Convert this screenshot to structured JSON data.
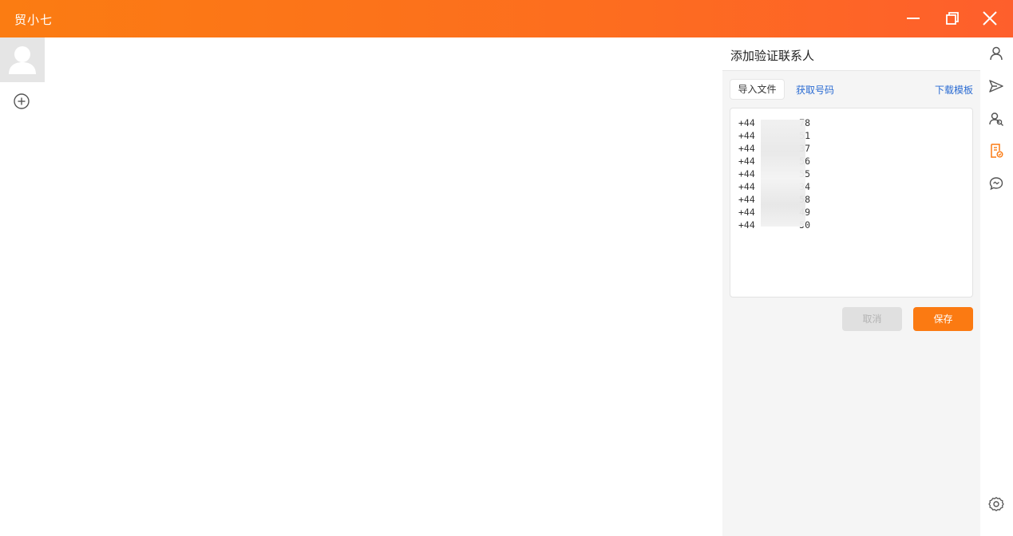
{
  "window": {
    "title": "贸小七"
  },
  "panel": {
    "title": "添加验证联系人",
    "tabs": {
      "import_file": "导入文件",
      "get_numbers": "获取号码",
      "download_template": "下载模板"
    },
    "numbers": [
      "+44        78",
      "+44        51",
      "+44        37",
      "+44        56",
      "+44        55",
      "+44        34",
      "+44        58",
      "+44        49",
      "+44        50"
    ],
    "cancel_label": "取消",
    "save_label": "保存"
  },
  "rail": {
    "active_item": "verify-contacts",
    "icons": [
      "user-icon",
      "send-icon",
      "contacts-icon",
      "verify-doc-icon",
      "chat-icon",
      "settings-icon"
    ]
  },
  "colors": {
    "accent": "#fb7a12",
    "link": "#2a6bd2",
    "titlebar_start": "#fb7c12",
    "titlebar_end": "#fe5f2c"
  }
}
